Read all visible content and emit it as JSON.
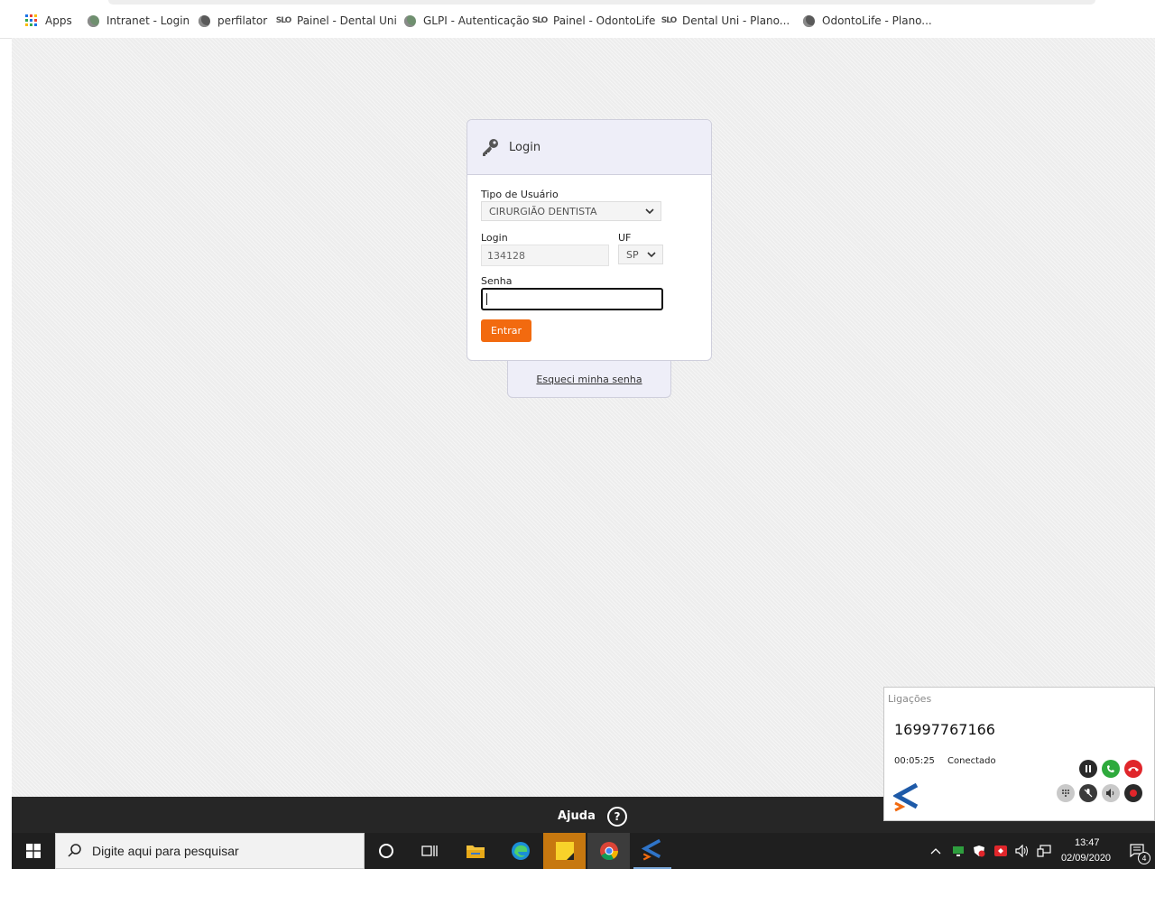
{
  "bookmarks": [
    {
      "label": "Apps",
      "icon": "apps-grid-icon"
    },
    {
      "label": "Intranet - Login",
      "icon": "globe-icon"
    },
    {
      "label": "perfilator",
      "icon": "globe-icon"
    },
    {
      "label": "Painel - Dental Uni",
      "icon": "slo-logo-icon"
    },
    {
      "label": "GLPI - Autenticação",
      "icon": "globe-icon"
    },
    {
      "label": "Painel - OdontoLife",
      "icon": "slo-logo-icon"
    },
    {
      "label": "Dental Uni - Plano...",
      "icon": "slo-logo-icon"
    },
    {
      "label": "OdontoLife - Plano...",
      "icon": "globe-icon"
    }
  ],
  "login": {
    "title": "Login",
    "user_type_label": "Tipo de Usuário",
    "user_type_value": "CIRURGIÃO DENTISTA",
    "login_label": "Login",
    "login_value": "134128",
    "uf_label": "UF",
    "uf_value": "SP",
    "password_label": "Senha",
    "password_value": "",
    "submit_label": "Entrar",
    "forgot_label": "Esqueci minha senha"
  },
  "help": {
    "label": "Ajuda",
    "icon_glyph": "?"
  },
  "calls": {
    "title": "Ligações",
    "number": "16997767166",
    "duration": "00:05:25",
    "status": "Conectado"
  },
  "taskbar": {
    "search_placeholder": "Digite aqui para pesquisar",
    "time": "13:47",
    "date": "02/09/2020",
    "notification_count": "4"
  },
  "colors": {
    "accent_orange": "#f26a0f",
    "header_lavender": "#eeeef8",
    "taskbar": "#1f1f1f",
    "help_bar": "#262626"
  }
}
